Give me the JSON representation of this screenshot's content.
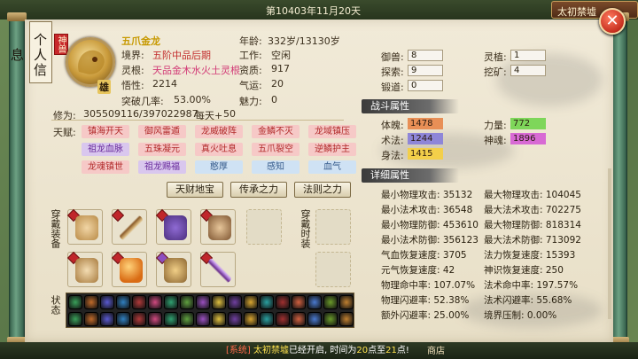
{
  "topbar": {
    "date": "第10403年11月20天",
    "map_button": "太初禁墟"
  },
  "close_label": "✕",
  "char_panel": {
    "title": "个人信息",
    "rank_tag": "神兽",
    "avatar_badge": "雄",
    "name": "五爪金龙",
    "realm_label": "境界:",
    "realm": "五阶中品后期",
    "root_label": "灵根:",
    "root": "天品金木水火土灵根",
    "wisdom_label": "悟性:",
    "wisdom": "2214",
    "crit_label": "突破几率:",
    "crit": "53.00%",
    "age_label": "年龄:",
    "age": "332岁/13130岁",
    "job_label": "工作:",
    "job": "空闲",
    "talent_label": "资质:",
    "talent": "917",
    "qiyun_label": "气运:",
    "qiyun": "20",
    "charm_label": "魅力:",
    "charm": "0",
    "cultivation_label": "修为:",
    "cultivation": "305509116/397022987",
    "daily_label": "每天+",
    "daily": "50",
    "tianfu_label": "天赋:"
  },
  "talents": [
    {
      "name": "镇海开天",
      "tier": "r"
    },
    {
      "name": "御风雷遁",
      "tier": "r"
    },
    {
      "name": "龙威破阵",
      "tier": "r"
    },
    {
      "name": "金鳞不灭",
      "tier": "r"
    },
    {
      "name": "龙域镇压",
      "tier": "r"
    },
    {
      "name": "祖龙血脉",
      "tier": "p"
    },
    {
      "name": "五珠凝元",
      "tier": "r"
    },
    {
      "name": "真火吐息",
      "tier": "r"
    },
    {
      "name": "五爪裂空",
      "tier": "r"
    },
    {
      "name": "逆鳞护主",
      "tier": "r"
    },
    {
      "name": "龙魂镇世",
      "tier": "r"
    },
    {
      "name": "祖龙赐福",
      "tier": "p"
    },
    {
      "name": "憨厚",
      "tier": "b"
    },
    {
      "name": "感知",
      "tier": "b"
    },
    {
      "name": "血气",
      "tier": "b"
    }
  ],
  "buttons": {
    "treasure": "天财地宝",
    "inherit": "传承之力",
    "law": "法则之力"
  },
  "equip": {
    "label": "穿戴装备",
    "fashion_label": "穿戴时装",
    "status_label": "状态"
  },
  "skills": {
    "yushou_label": "御兽:",
    "yushou": "8",
    "tansuo_label": "探索:",
    "tansuo": "9",
    "duandao_label": "锻道:",
    "duandao": "0",
    "lingzhi_label": "灵植:",
    "lingzhi": "1",
    "wakuang_label": "挖矿:",
    "wakuang": "4"
  },
  "combat": {
    "title": "战斗属性",
    "tipo_label": "体魄:",
    "tipo": "1478",
    "shufa_label": "术法:",
    "shufa": "1244",
    "shenfa_label": "身法:",
    "shenfa": "1415",
    "liliang_label": "力量:",
    "liliang": "772",
    "shenhun_label": "神魂:",
    "shenhun": "1896"
  },
  "detail": {
    "title": "详细属性",
    "rows": [
      [
        "最小物理攻击: 35132",
        "最大物理攻击: 104045"
      ],
      [
        "最小法术攻击: 36548",
        "最大法术攻击: 702275"
      ],
      [
        "最小物理防御: 453610",
        "最大物理防御: 818314"
      ],
      [
        "最小法术防御: 356123",
        "最大法术防御: 713092"
      ],
      [
        "气血恢复速度: 3705",
        "法力恢复速度: 15393"
      ],
      [
        "元气恢复速度: 42",
        "神识恢复速度: 250"
      ],
      [
        "物理命中率: 107.07%",
        "法术命中率: 197.57%"
      ],
      [
        "物理闪避率: 52.38%",
        "法术闪避率: 55.68%"
      ],
      [
        "额外闪避率: 25.00%",
        "境界压制: 0.00%"
      ]
    ]
  },
  "announcement": {
    "tag": "[系统]",
    "place": "太初禁墟",
    "text1": "已经开启, 时间为",
    "t1": "20",
    "text2": "点至",
    "t2": "21",
    "text3": "点!"
  },
  "shortcut": "商店",
  "colors": {
    "red_tier": "#f6c9c7",
    "purple_tier": "#d9c7ee",
    "blue_tier": "#cfe2f4",
    "tipo_bar": "#e88f56",
    "shufa_bar": "#8e86d8",
    "shenfa_bar": "#f3cf4a",
    "liliang_bar": "#7ed65a",
    "shenhun_bar": "#d86ad4"
  }
}
